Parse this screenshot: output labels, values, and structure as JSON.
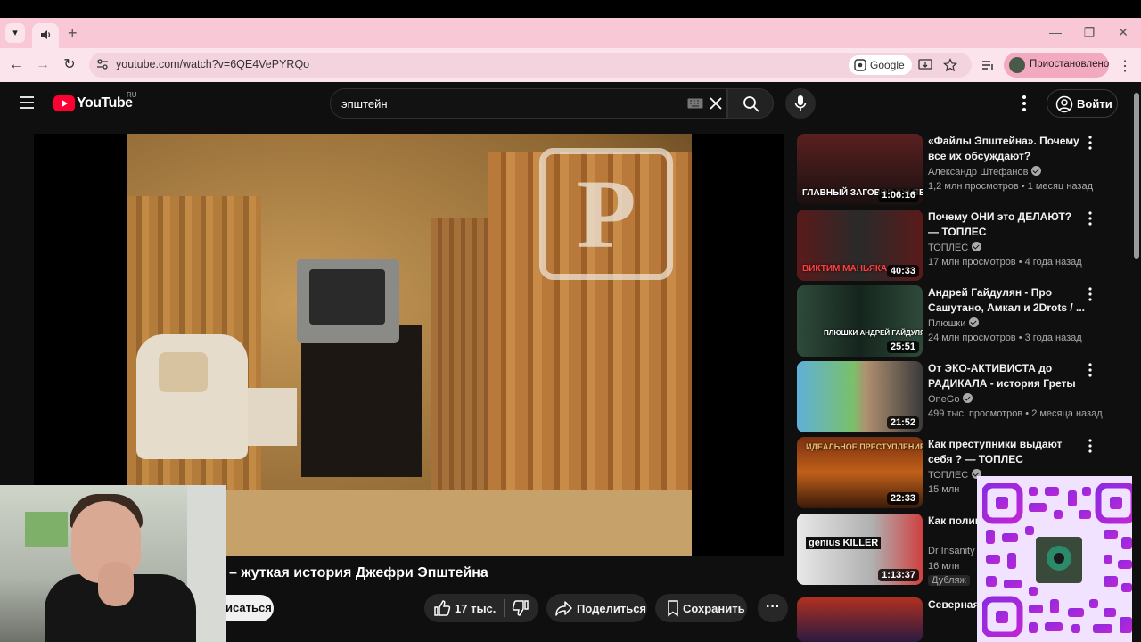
{
  "browser": {
    "url": "youtube.com/watch?v=6QE4VePYRQo",
    "search_engine_chip": "Google",
    "profile_label": "Приостановлено"
  },
  "header": {
    "logo_text": "YouTube",
    "region": "RU",
    "search_value": "эпштейн",
    "signin_label": "Войти"
  },
  "video": {
    "title_visible": "– жуткая история Джефри Эпштейна",
    "subscribe_label_partial": "исаться",
    "likes": "17 тыс.",
    "share_label": "Поделиться",
    "save_label": "Сохранить",
    "watermark_letter": "P"
  },
  "recommendations": [
    {
      "title": "«Файлы Эпштейна». Почему все их обсуждают?",
      "channel": "Александр Штефанов",
      "verified": true,
      "views": "1,2 млн просмотров",
      "age": "1 месяц назад",
      "duration": "1:06:16",
      "thumb_text": "ГЛАВНЫЙ ЗАГОВОР XXI ВЕКА",
      "thumb_color": "#3b1f1f"
    },
    {
      "title": "Почему ОНИ это ДЕЛАЮТ? — ТОПЛЕС",
      "channel": "ТОПЛЕС",
      "verified": true,
      "views": "17 млн просмотров",
      "age": "4 года назад",
      "duration": "40:33",
      "thumb_text": "ВИКТИМ МАНЬЯКА",
      "thumb_color": "#4a1a1a"
    },
    {
      "title": "Андрей Гайдулян - Про Сашутано, Амкал и 2Drots / ...",
      "channel": "Плюшки",
      "verified": true,
      "views": "24 млн просмотров",
      "age": "3 года назад",
      "duration": "25:51",
      "thumb_text": "ПЛЮШКИ АНДРЕЙ ГАЙДУЛЯН",
      "thumb_color": "#1b3b2e"
    },
    {
      "title": "От ЭКО-АКТИВИСТА до РАДИКАЛА - история Греты ...",
      "channel": "OneGo",
      "verified": true,
      "views": "499 тыс. просмотров",
      "age": "2 месяца назад",
      "duration": "21:52",
      "thumb_text": "",
      "thumb_color": "#4a6a3a"
    },
    {
      "title": "Как преступники выдают себя ? — ТОПЛЕС",
      "channel": "ТОПЛЕС",
      "verified": true,
      "views": "15 млн",
      "age": "",
      "duration": "22:33",
      "thumb_text": "ИДЕАЛЬНОЕ ПРЕСТУПЛЕНИЕ",
      "thumb_color": "#5a2a12"
    },
    {
      "title": "Как полиц... умного уб...",
      "channel": "Dr Insanity",
      "verified": false,
      "views": "16 млн",
      "age": "",
      "extra": "Дубляж",
      "duration": "1:13:37",
      "thumb_text": "genius KILLER",
      "thumb_color": "#c9c9c9"
    },
    {
      "title": "Северная ... диктатур...",
      "channel": "",
      "verified": false,
      "views": "",
      "age": "",
      "duration": "",
      "thumb_text": "",
      "thumb_color": "#8a2a1a"
    }
  ]
}
